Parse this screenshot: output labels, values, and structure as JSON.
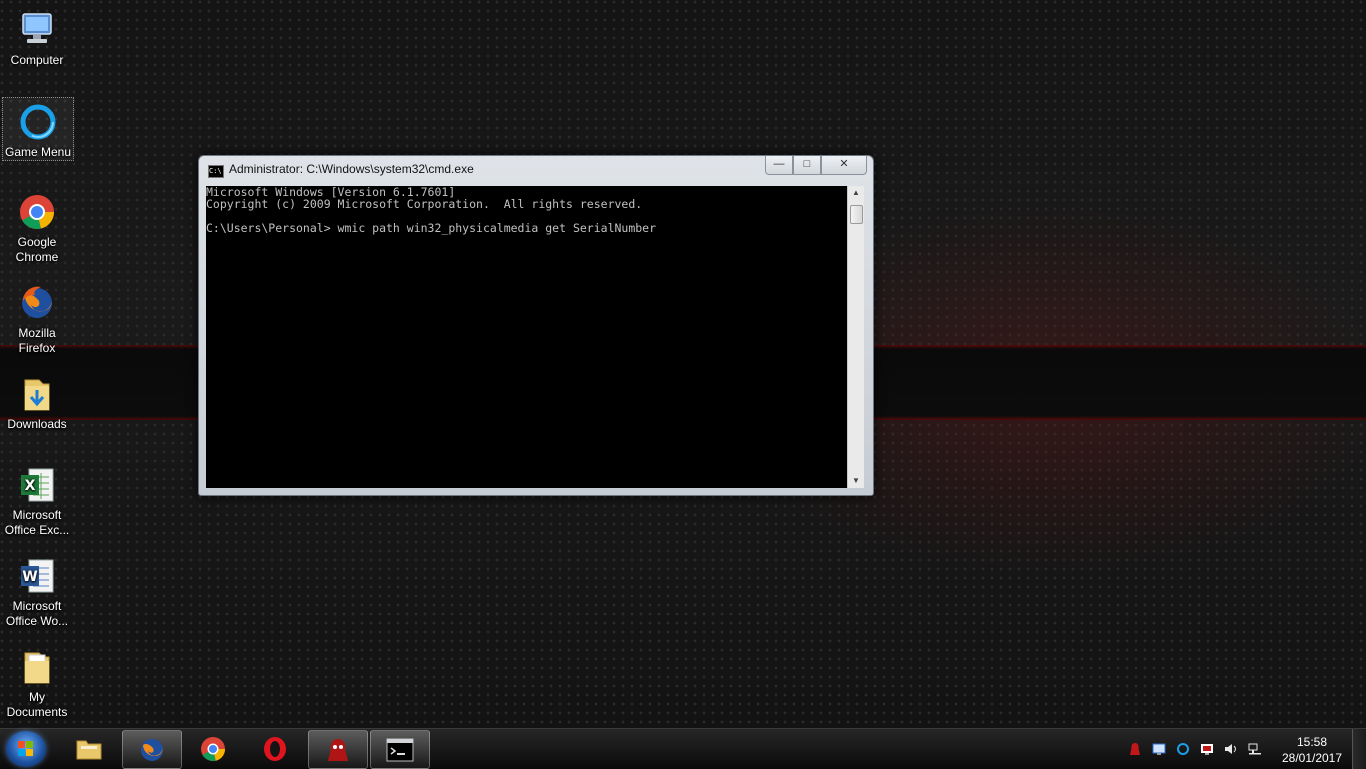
{
  "desktop": {
    "icons": [
      {
        "label": "Computer",
        "icon": "computer-icon"
      },
      {
        "label": "Game Menu",
        "icon": "game-menu-icon"
      },
      {
        "label": "Google Chrome",
        "icon": "chrome-icon"
      },
      {
        "label": "Mozilla Firefox",
        "icon": "firefox-icon"
      },
      {
        "label": "Downloads",
        "icon": "downloads-folder-icon"
      },
      {
        "label": "Microsoft Office Exc...",
        "icon": "excel-icon"
      },
      {
        "label": "Microsoft Office Wo...",
        "icon": "word-icon"
      },
      {
        "label": "My Documents",
        "icon": "documents-folder-icon"
      }
    ]
  },
  "cmd_window": {
    "title": "Administrator: C:\\Windows\\system32\\cmd.exe",
    "title_icon_text": "C:\\",
    "minimize_label": "—",
    "maximize_label": "□",
    "close_label": "✕",
    "lines": [
      "Microsoft Windows [Version 6.1.7601]",
      "Copyright (c) 2009 Microsoft Corporation.  All rights reserved.",
      "",
      "C:\\Users\\Personal> wmic path win32_physicalmedia get SerialNumber"
    ]
  },
  "taskbar": {
    "pinned": [
      {
        "name": "explorer",
        "icon": "file-explorer-icon"
      },
      {
        "name": "firefox",
        "icon": "firefox-icon",
        "active": true
      },
      {
        "name": "chrome",
        "icon": "chrome-icon"
      },
      {
        "name": "opera",
        "icon": "opera-icon"
      },
      {
        "name": "game",
        "icon": "game-app-icon"
      },
      {
        "name": "cmd",
        "icon": "cmd-icon"
      }
    ],
    "tray_icons": [
      "red-app-tray-icon",
      "monitor-tray-icon",
      "game-menu-tray-icon",
      "flag-tray-icon",
      "volume-icon",
      "network-icon"
    ],
    "time": "15:58",
    "date": "28/01/2017"
  }
}
